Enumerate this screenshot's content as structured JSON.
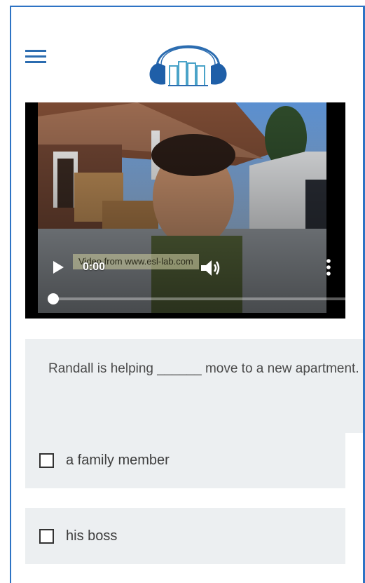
{
  "header": {
    "menu_icon": "hamburger-menu-icon",
    "logo_icon": "headphones-books-logo-icon",
    "colors": {
      "brand_blue": "#2b6cb0",
      "frame_border": "#2d73c4"
    }
  },
  "video": {
    "time": "0:00",
    "watermark": "Video from www.esl-lab.com",
    "progress": 0,
    "icons": [
      "play-icon",
      "volume-icon",
      "more-vertical-icon"
    ]
  },
  "question": {
    "text": "Randall is helping ______ move to a new apartment."
  },
  "answers": [
    {
      "label": "a family member",
      "checked": false
    },
    {
      "label": "his boss",
      "checked": false
    }
  ]
}
